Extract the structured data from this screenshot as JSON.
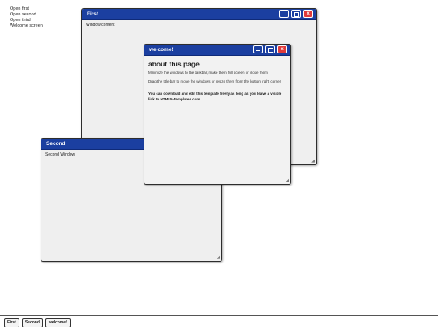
{
  "launcher": {
    "items": [
      "Open first",
      "Open second",
      "Open third",
      "Welcome screen"
    ]
  },
  "windows": {
    "first": {
      "title": "First",
      "content": "Window content"
    },
    "second": {
      "title": "Second",
      "content": "Second Window"
    },
    "welcome": {
      "title": "welcome!",
      "heading": "about this page",
      "p1": "Minimize the windows to the taskbar, make them full screen or close them.",
      "p2": "Drag the title bar to move the windows or resize them from the bottom right corner.",
      "p3": "You can download and edit this template freely as long as you leave a visible link to HTML5-Templates.com"
    }
  },
  "taskbar": {
    "items": [
      "First",
      "Second",
      "welcome!"
    ]
  },
  "colors": {
    "titlebar": "#1b3fa0",
    "close": "#e03a3a",
    "window_bg": "#efefef"
  },
  "icons": {
    "minimize": "minimize-icon",
    "maximize": "maximize-icon",
    "close": "close-icon",
    "resize": "resize-grip-icon"
  }
}
